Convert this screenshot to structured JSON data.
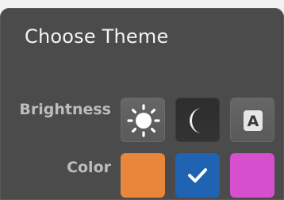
{
  "dialog": {
    "title": "Choose Theme",
    "brightness": {
      "label": "Brightness",
      "options": [
        {
          "icon": "sun-icon",
          "selected": false
        },
        {
          "icon": "moon-icon",
          "selected": true
        },
        {
          "icon": "auto-a-icon",
          "glyph": "A",
          "selected": false
        }
      ]
    },
    "color": {
      "label": "Color",
      "options": [
        {
          "swatch": "#e8873c",
          "selected": false
        },
        {
          "swatch": "#1f63b2",
          "selected": true,
          "icon": "checkmark-icon"
        },
        {
          "swatch": "#d64fcc",
          "selected": false
        }
      ]
    }
  }
}
